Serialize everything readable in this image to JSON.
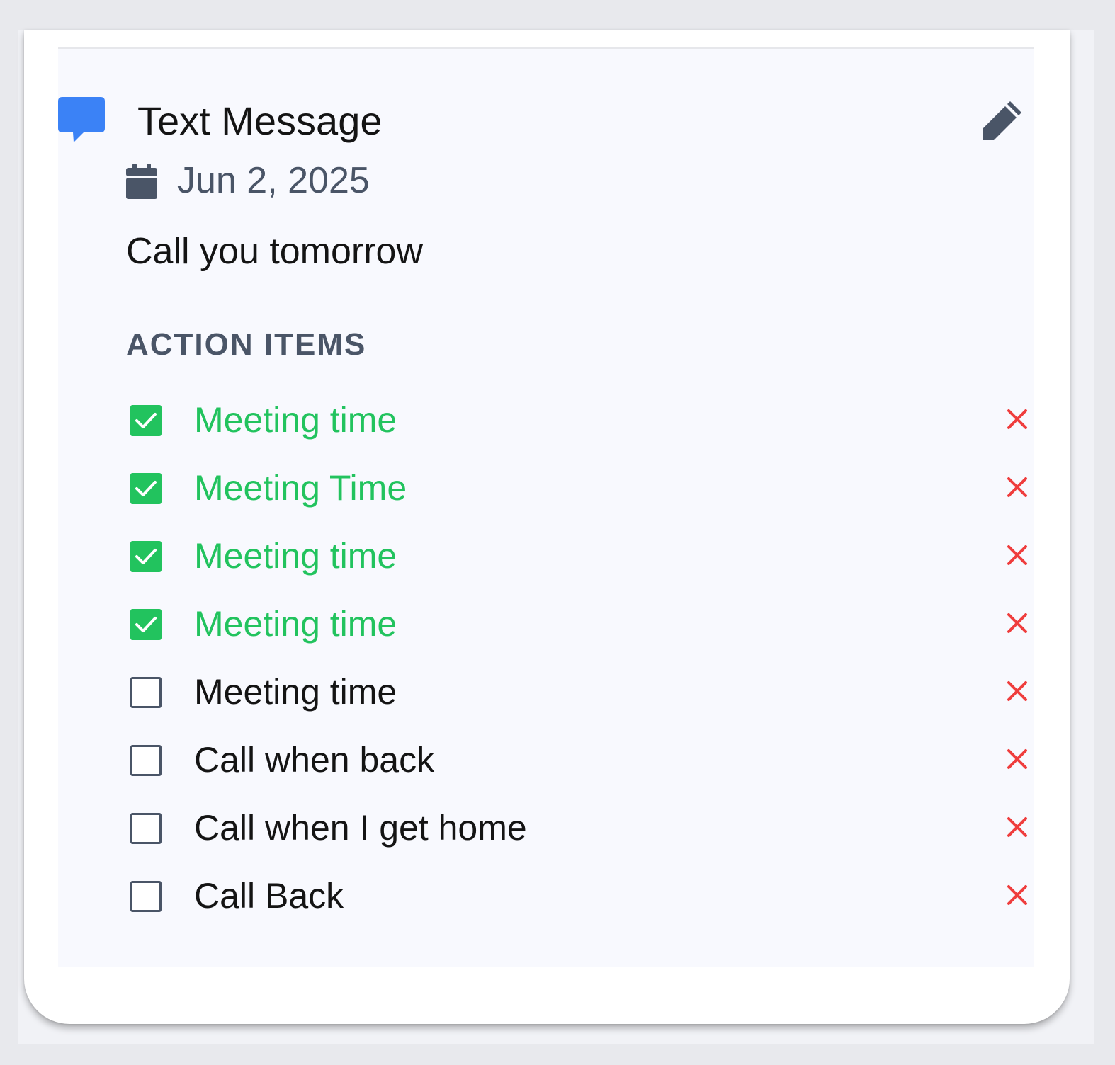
{
  "entry": {
    "type_label": "Text Message",
    "date": "Jun 2, 2025",
    "message": "Call you tomorrow",
    "icons": {
      "type": "chat-bubble-icon",
      "edit": "pencil-icon",
      "date": "calendar-icon",
      "delete": "close-icon"
    }
  },
  "action_items": {
    "heading": "ACTION ITEMS",
    "items": [
      {
        "label": "Meeting time",
        "done": true
      },
      {
        "label": "Meeting Time",
        "done": true
      },
      {
        "label": "Meeting time",
        "done": true
      },
      {
        "label": "Meeting time",
        "done": true
      },
      {
        "label": "Meeting time",
        "done": false
      },
      {
        "label": "Call when back",
        "done": false
      },
      {
        "label": "Call when I get home",
        "done": false
      },
      {
        "label": "Call Back",
        "done": false
      }
    ]
  },
  "colors": {
    "chat_icon": "#3b82f6",
    "done_text": "#22c35e",
    "muted_text": "#4a5567",
    "delete": "#ef3d3d",
    "panel_background": "#f8f9fe"
  }
}
